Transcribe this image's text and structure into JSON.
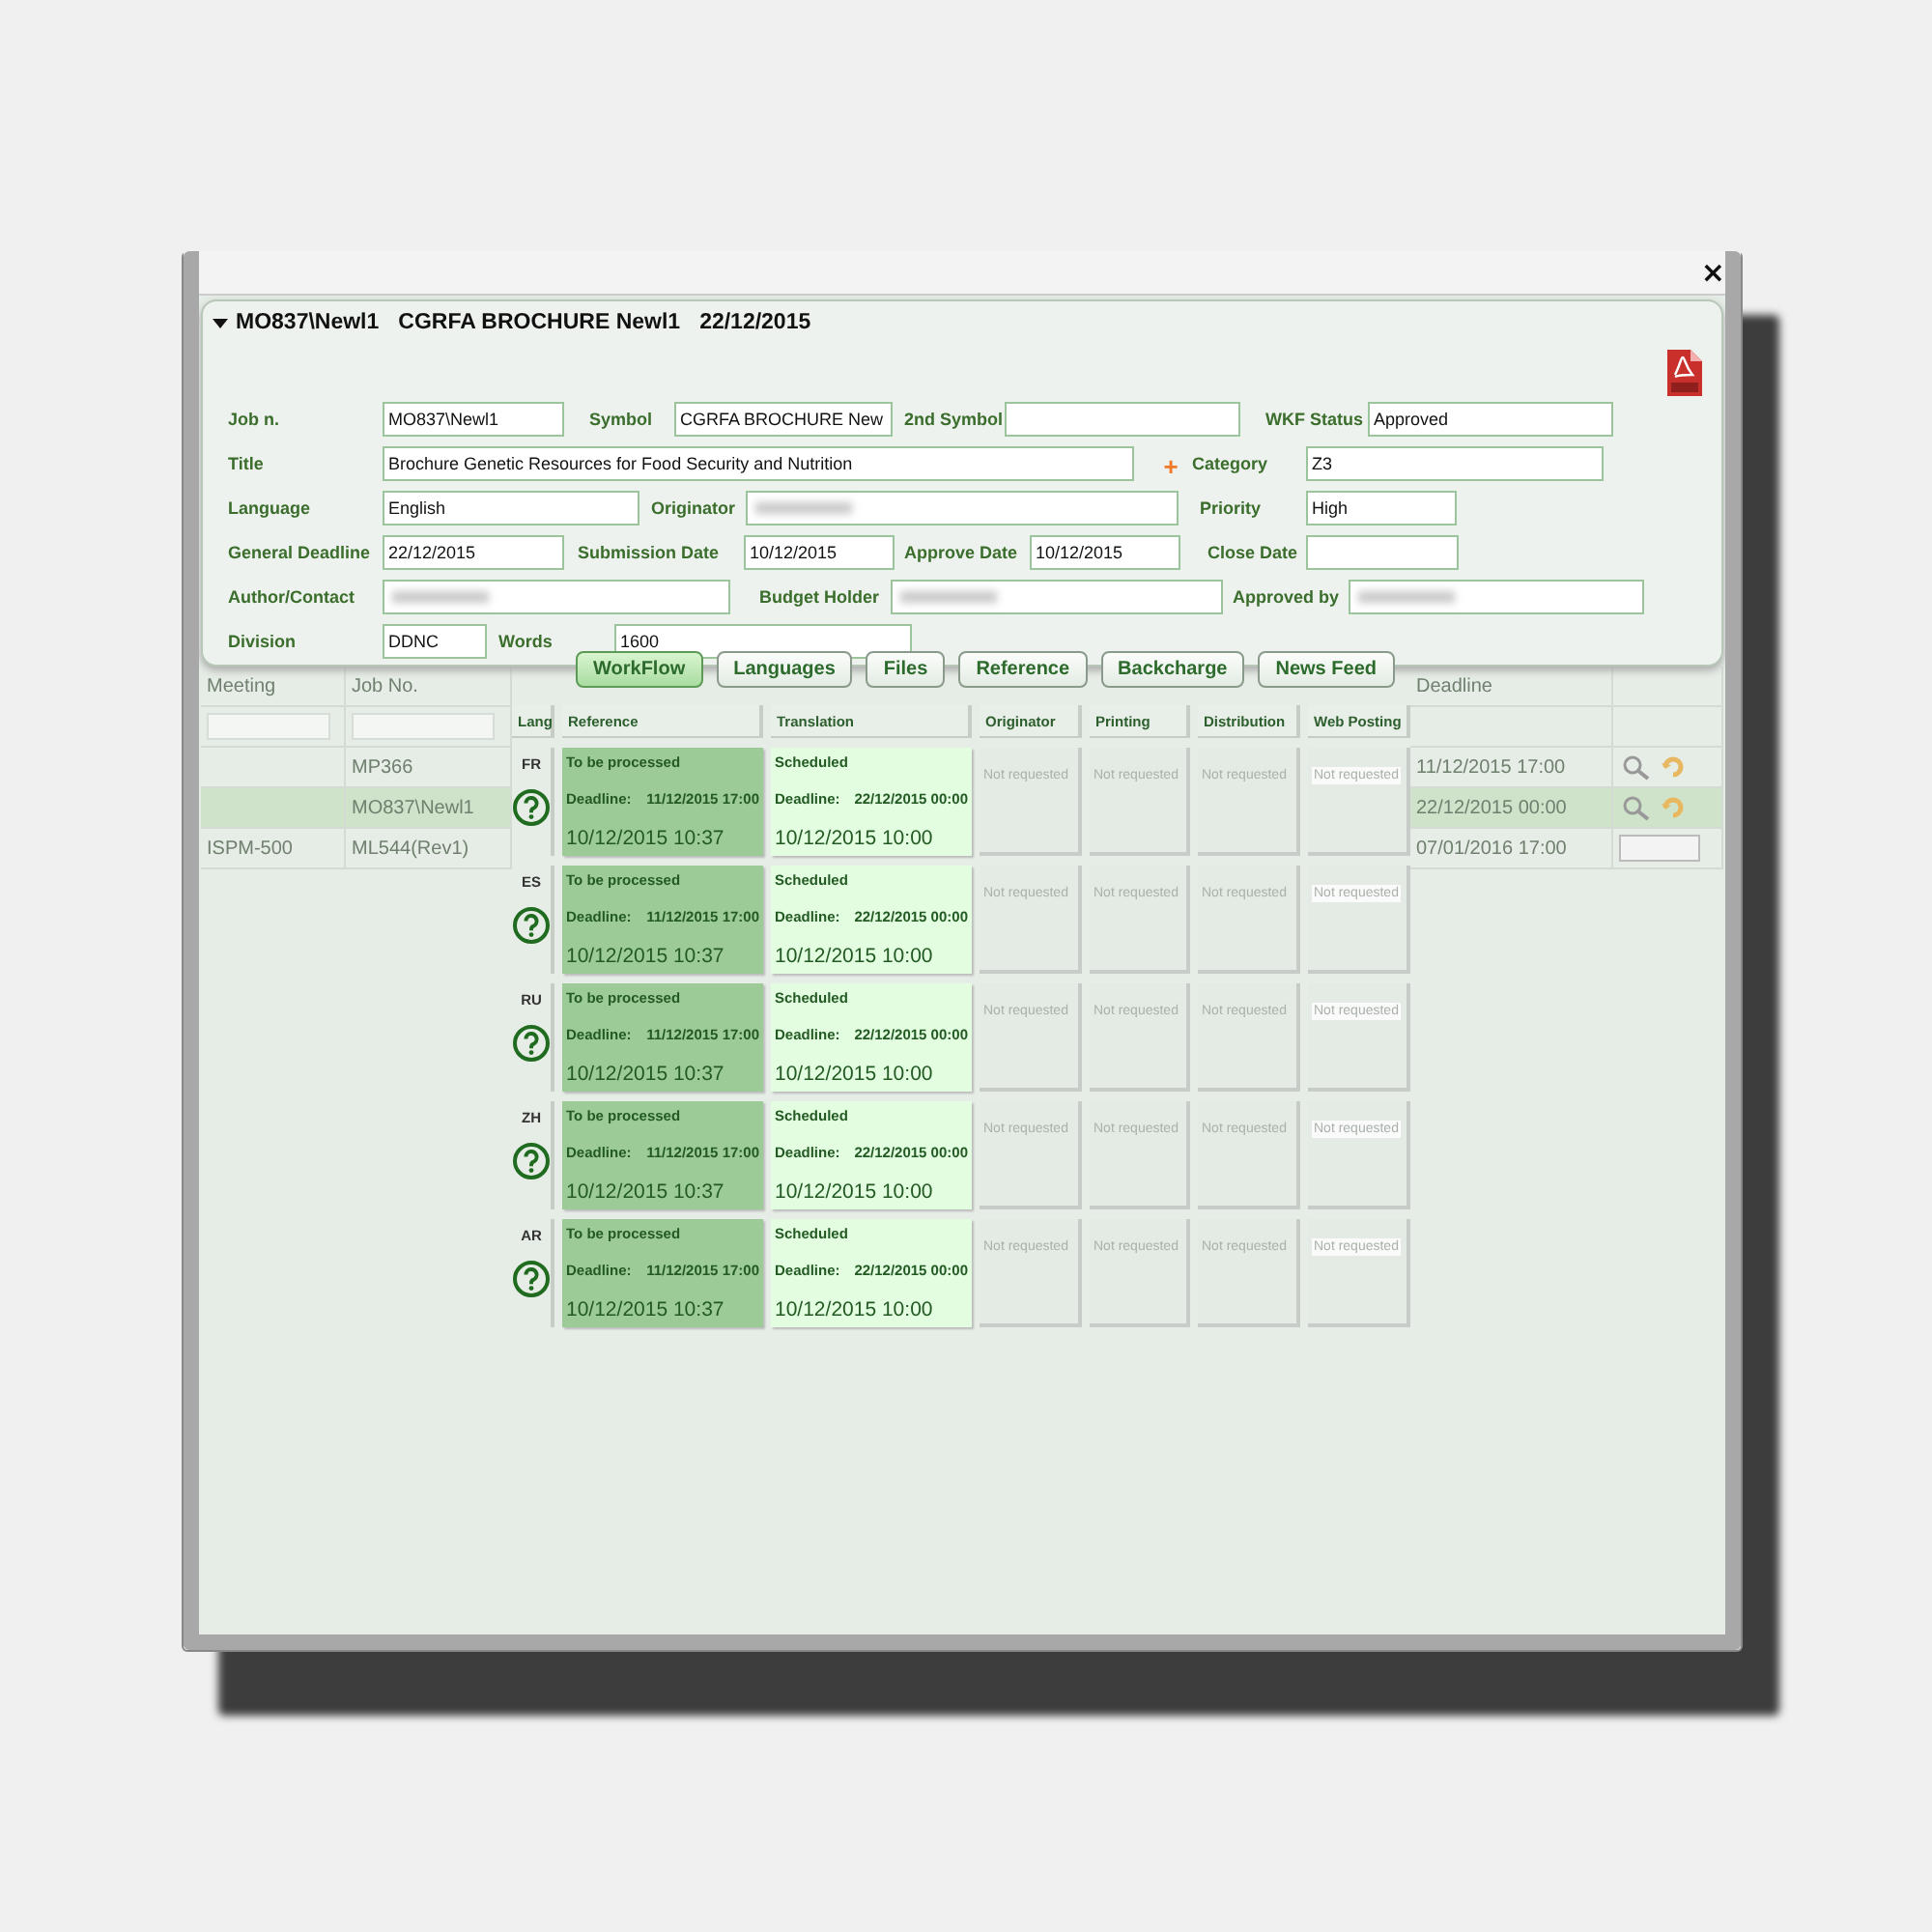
{
  "window": {
    "close": "×"
  },
  "header": {
    "expanded": true,
    "job": "MO837\\Newl1",
    "symbol": "CGRFA BROCHURE Newl1",
    "date": "22/12/2015"
  },
  "form": {
    "rows": [
      [
        {
          "kind": "field",
          "label": "Job n.",
          "value": "MO837\\Newl1"
        },
        {
          "kind": "field",
          "label": "Symbol",
          "value": "CGRFA BROCHURE New"
        },
        {
          "kind": "field",
          "label": "2nd Symbol"
        },
        {
          "kind": "field",
          "label": "WKF Status",
          "value": "Approved"
        }
      ],
      [
        {
          "kind": "field",
          "label": "Title",
          "value": "Brochure Genetic Resources for Food Security and Nutrition"
        },
        {
          "kind": "add",
          "text": "+"
        },
        {
          "kind": "field",
          "label": "Category",
          "value": "Z3"
        }
      ],
      [
        {
          "kind": "field",
          "label": "Language",
          "value": "English"
        },
        {
          "kind": "field",
          "label": "Originator",
          "redacted": true
        },
        {
          "kind": "field",
          "label": "Priority",
          "value": "High"
        }
      ],
      [
        {
          "kind": "field",
          "label": "General Deadline",
          "value": "22/12/2015"
        },
        {
          "kind": "field",
          "label": "Submission Date",
          "value": "10/12/2015"
        },
        {
          "kind": "field",
          "label": "Approve Date",
          "value": "10/12/2015"
        },
        {
          "kind": "field",
          "label": "Close Date"
        }
      ],
      [
        {
          "kind": "field",
          "label": "Author/Contact",
          "redacted": true
        },
        {
          "kind": "field",
          "label": "Budget Holder",
          "redacted": true
        },
        {
          "kind": "field",
          "label": "Approved by",
          "redacted": true
        }
      ],
      [
        {
          "kind": "field",
          "label": "Division",
          "value": "DDNC"
        },
        {
          "kind": "field",
          "label": "Words",
          "value": "1600"
        }
      ]
    ]
  },
  "tabs": [
    {
      "label": "WorkFlow",
      "selected": true
    },
    {
      "label": "Languages",
      "selected": false
    },
    {
      "label": "Files",
      "selected": false
    },
    {
      "label": "Reference",
      "selected": false
    },
    {
      "label": "Backcharge",
      "selected": false
    },
    {
      "label": "News Feed",
      "selected": false
    }
  ],
  "workflow": {
    "columns": [
      "Lang",
      "Reference",
      "Translation",
      "Originator",
      "Printing",
      "Distribution",
      "Web Posting"
    ],
    "rows": [
      {
        "lang": "FR",
        "reference": {
          "kind": "pending",
          "status": "To be processed",
          "deadline_label": "Deadline:",
          "deadline": "11/12/2015 17:00",
          "date": "10/12/2015 10:37"
        },
        "translation": {
          "kind": "scheduled",
          "status": "Scheduled",
          "deadline_label": "Deadline:",
          "deadline": "22/12/2015 00:00",
          "date": "10/12/2015 10:00"
        },
        "others": [
          "Not requested",
          "Not requested",
          "Not requested",
          "Not requested"
        ]
      },
      {
        "lang": "ES",
        "reference": {
          "kind": "pending",
          "status": "To be processed",
          "deadline_label": "Deadline:",
          "deadline": "11/12/2015 17:00",
          "date": "10/12/2015 10:37"
        },
        "translation": {
          "kind": "scheduled",
          "status": "Scheduled",
          "deadline_label": "Deadline:",
          "deadline": "22/12/2015 00:00",
          "date": "10/12/2015 10:00"
        },
        "others": [
          "Not requested",
          "Not requested",
          "Not requested",
          "Not requested"
        ]
      },
      {
        "lang": "RU",
        "reference": {
          "kind": "pending",
          "status": "To be processed",
          "deadline_label": "Deadline:",
          "deadline": "11/12/2015 17:00",
          "date": "10/12/2015 10:37"
        },
        "translation": {
          "kind": "scheduled",
          "status": "Scheduled",
          "deadline_label": "Deadline:",
          "deadline": "22/12/2015 00:00",
          "date": "10/12/2015 10:00"
        },
        "others": [
          "Not requested",
          "Not requested",
          "Not requested",
          "Not requested"
        ]
      },
      {
        "lang": "ZH",
        "reference": {
          "kind": "pending",
          "status": "To be processed",
          "deadline_label": "Deadline:",
          "deadline": "11/12/2015 17:00",
          "date": "10/12/2015 10:37"
        },
        "translation": {
          "kind": "scheduled",
          "status": "Scheduled",
          "deadline_label": "Deadline:",
          "deadline": "22/12/2015 00:00",
          "date": "10/12/2015 10:00"
        },
        "others": [
          "Not requested",
          "Not requested",
          "Not requested",
          "Not requested"
        ]
      },
      {
        "lang": "AR",
        "reference": {
          "kind": "pending",
          "status": "To be processed",
          "deadline_label": "Deadline:",
          "deadline": "11/12/2015 17:00",
          "date": "10/12/2015 10:37"
        },
        "translation": {
          "kind": "scheduled",
          "status": "Scheduled",
          "deadline_label": "Deadline:",
          "deadline": "22/12/2015 00:00",
          "date": "10/12/2015 10:00"
        },
        "others": [
          "Not requested",
          "Not requested",
          "Not requested",
          "Not requested"
        ]
      }
    ]
  },
  "background_grid": {
    "meeting": "Meeting",
    "job_no": "Job No.",
    "deadline": "Deadline",
    "rows": [
      {
        "meeting": "",
        "job": "MP366",
        "deadline": "11/12/2015 17:00",
        "selected": false,
        "kind": "actions"
      },
      {
        "meeting": "",
        "job": "MO837\\Newl1",
        "deadline": "22/12/2015 00:00",
        "selected": true,
        "kind": "actions"
      },
      {
        "meeting": "ISPM-500",
        "job": "ML544(Rev1)",
        "deadline": "07/01/2016 17:00",
        "selected": false,
        "kind": "pager"
      }
    ]
  }
}
